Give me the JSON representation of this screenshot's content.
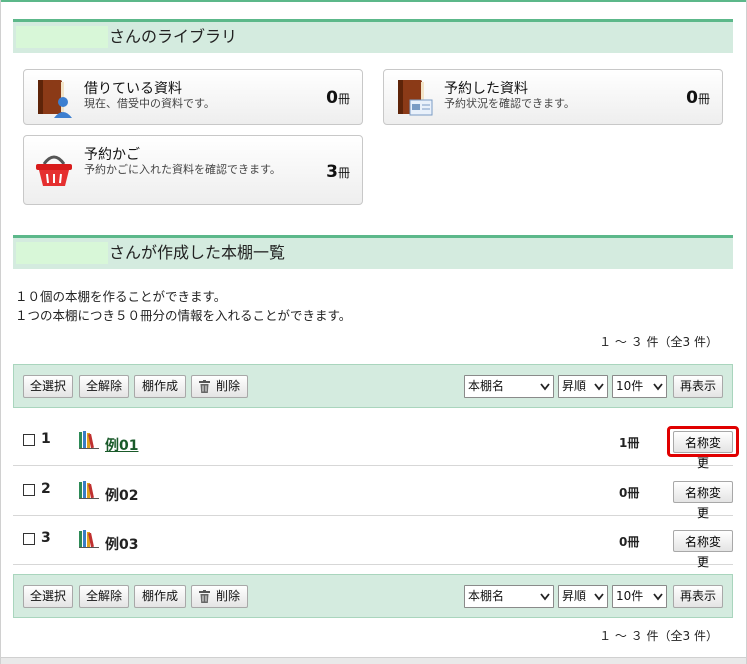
{
  "library": {
    "header_suffix": "さんのライブラリ",
    "cards": [
      {
        "title": "借りている資料",
        "desc": "現在、借受中の資料です。",
        "count": "0",
        "unit": "冊",
        "icon": "borrowed-book-icon"
      },
      {
        "title": "予約した資料",
        "desc": "予約状況を確認できます。",
        "count": "0",
        "unit": "冊",
        "icon": "reserved-book-icon"
      },
      {
        "title": "予約かご",
        "desc": "予約かごに入れた資料を確認できます。",
        "count": "3",
        "unit": "冊",
        "icon": "basket-icon"
      }
    ]
  },
  "shelves": {
    "header_suffix": "さんが作成した本棚一覧",
    "info_line1": "１０個の本棚を作ることができます。",
    "info_line2": "１つの本棚につき５０冊分の情報を入れることができます。",
    "range": "１ ～ ３ 件（全3 件）",
    "toolbar": {
      "select_all": "全選択",
      "deselect_all": "全解除",
      "create": "棚作成",
      "delete": "削除",
      "sort_field": "本棚名",
      "sort_order": "昇順",
      "per_page": "10件",
      "refresh": "再表示"
    },
    "rows": [
      {
        "num": "1",
        "name": "例01",
        "count": "1冊",
        "rename": "名称変更"
      },
      {
        "num": "2",
        "name": "例02",
        "count": "0冊",
        "rename": "名称変更"
      },
      {
        "num": "3",
        "name": "例03",
        "count": "0冊",
        "rename": "名称変更"
      }
    ]
  },
  "colors": {
    "accent": "#5cb88a",
    "header_bg": "#d4ebdf",
    "highlight": "#e00000"
  }
}
